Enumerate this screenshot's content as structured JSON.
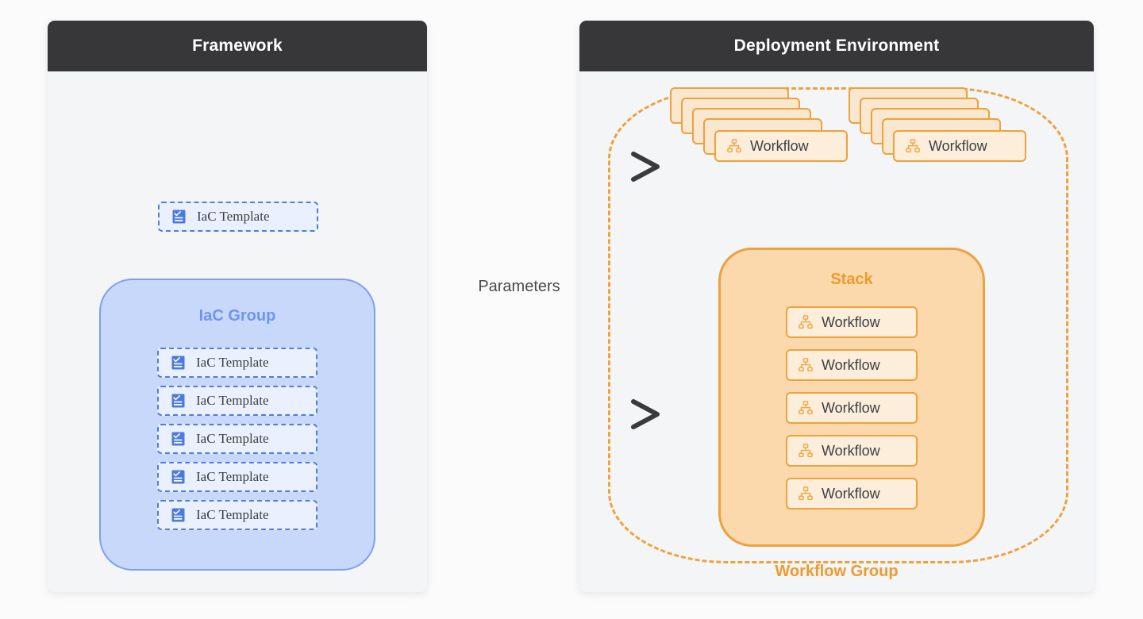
{
  "page": {
    "background_color": "#fbfbfc"
  },
  "panels": {
    "framework": {
      "title": "Framework",
      "header_color": "#37373a",
      "body_color": "#f4f5f6",
      "standalone_template": {
        "label": "IaC Template",
        "icon": "template-checklist-icon",
        "border_color": "#4f7ce0",
        "fill_color": "#eaf0fd"
      },
      "iac_group": {
        "title": "IaC Group",
        "accent_color": "#6f95ee",
        "fill_color": "#c8d8fb",
        "border_color": "#7f9ff0",
        "templates": [
          {
            "label": "IaC Template",
            "icon": "template-checklist-icon"
          },
          {
            "label": "IaC Template",
            "icon": "template-checklist-icon"
          },
          {
            "label": "IaC Template",
            "icon": "template-checklist-icon"
          },
          {
            "label": "IaC Template",
            "icon": "template-checklist-icon"
          },
          {
            "label": "IaC Template",
            "icon": "template-checklist-icon"
          }
        ]
      }
    },
    "deployment": {
      "title": "Deployment Environment",
      "header_color": "#37373a",
      "body_color": "#f4f5f6",
      "workflow_group": {
        "label": "Workflow Group",
        "accent_color": "#ef9a2e",
        "border_style": "dashed"
      },
      "workflow_stacks": [
        {
          "label": "Workflow",
          "icon": "workflow-hierarchy-icon",
          "card_count": 5
        },
        {
          "label": "Workflow",
          "icon": "workflow-hierarchy-icon",
          "card_count": 5
        }
      ],
      "stack": {
        "title": "Stack",
        "accent_color": "#ef9a2e",
        "fill_color": "#fbd9ac",
        "border_color": "#eda13f",
        "workflows": [
          {
            "label": "Workflow",
            "icon": "workflow-hierarchy-icon"
          },
          {
            "label": "Workflow",
            "icon": "workflow-hierarchy-icon"
          },
          {
            "label": "Workflow",
            "icon": "workflow-hierarchy-icon"
          },
          {
            "label": "Workflow",
            "icon": "workflow-hierarchy-icon"
          },
          {
            "label": "Workflow",
            "icon": "workflow-hierarchy-icon"
          }
        ]
      }
    }
  },
  "connectors": {
    "label": "Parameters",
    "label_color": "#4a4a4d",
    "arrows": [
      {
        "name": "template-to-workflows",
        "direction": "left-to-right"
      },
      {
        "name": "group-to-stack",
        "direction": "left-to-right"
      }
    ],
    "gradient_from": "#e8eaed",
    "gradient_to": "#3a3a3d"
  }
}
